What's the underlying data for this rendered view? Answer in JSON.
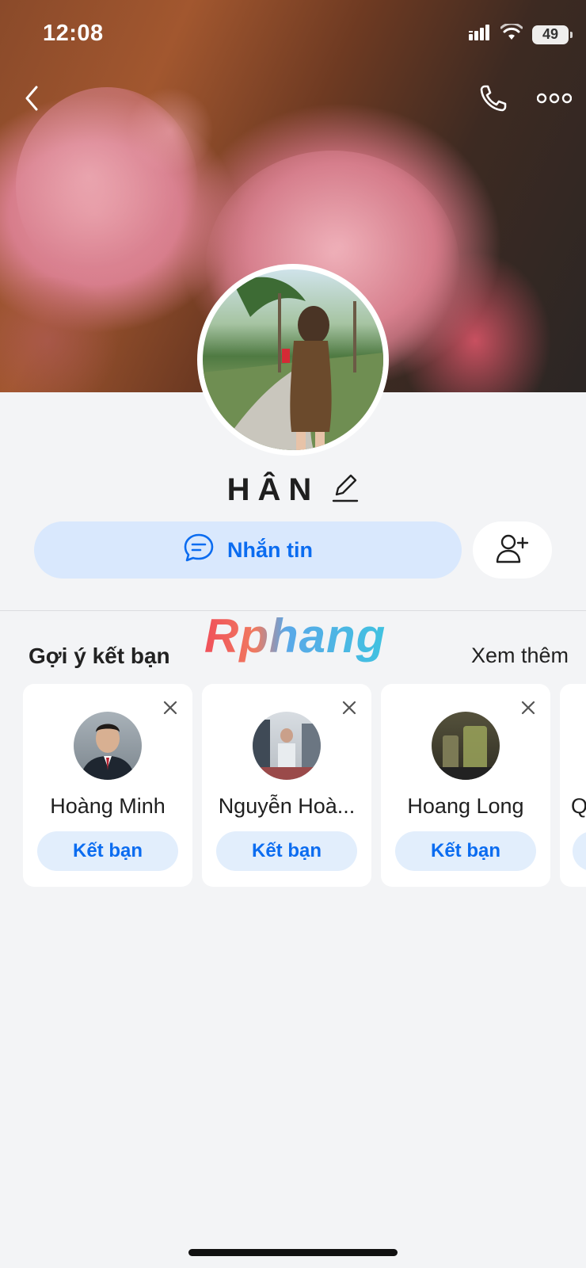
{
  "status_bar": {
    "time": "12:08",
    "battery": "49"
  },
  "profile": {
    "name": "HÂN"
  },
  "actions": {
    "message_label": "Nhắn tin"
  },
  "watermark": {
    "text": "Rphang"
  },
  "suggestions": {
    "title": "Gợi ý kết bạn",
    "see_more": "Xem thêm",
    "items": [
      {
        "name": "Hoàng Minh",
        "button": "Kết bạn"
      },
      {
        "name": "Nguyễn Hoà...",
        "button": "Kết bạn"
      },
      {
        "name": "Hoang Long",
        "button": "Kết bạn"
      },
      {
        "name": "Q",
        "button": ""
      }
    ]
  },
  "icons": [
    "back-icon",
    "phone-icon",
    "more-icon",
    "edit-icon",
    "chat-icon",
    "add-friend-icon",
    "close-icon",
    "signal-icon",
    "wifi-icon",
    "battery-icon"
  ],
  "colors": {
    "accent": "#0b6cf0",
    "accent_bg": "#d9e8fd",
    "page_bg": "#f3f4f6"
  }
}
